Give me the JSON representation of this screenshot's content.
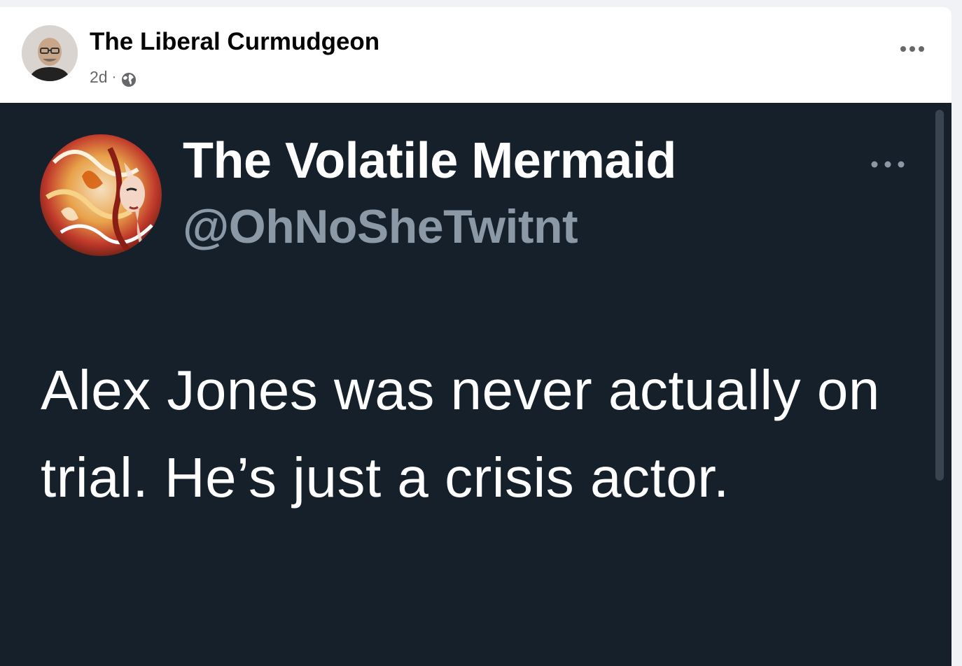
{
  "post": {
    "author": "The Liberal Curmudgeon",
    "time": "2d",
    "separator": "·",
    "privacy_icon": "globe-icon",
    "more_icon": "more-horizontal-icon"
  },
  "tweet": {
    "display_name": "The Volatile Mermaid",
    "handle": "@OhNoSheTwitnt",
    "text": "Alex Jones was never actually on trial. He’s just a crisis actor.",
    "more_icon": "more-horizontal-icon"
  },
  "colors": {
    "page_bg": "#f0f2f5",
    "card_bg": "#ffffff",
    "tweet_bg": "#15202b",
    "tweet_handle": "#8b98a5",
    "meta_text": "#65676b"
  }
}
